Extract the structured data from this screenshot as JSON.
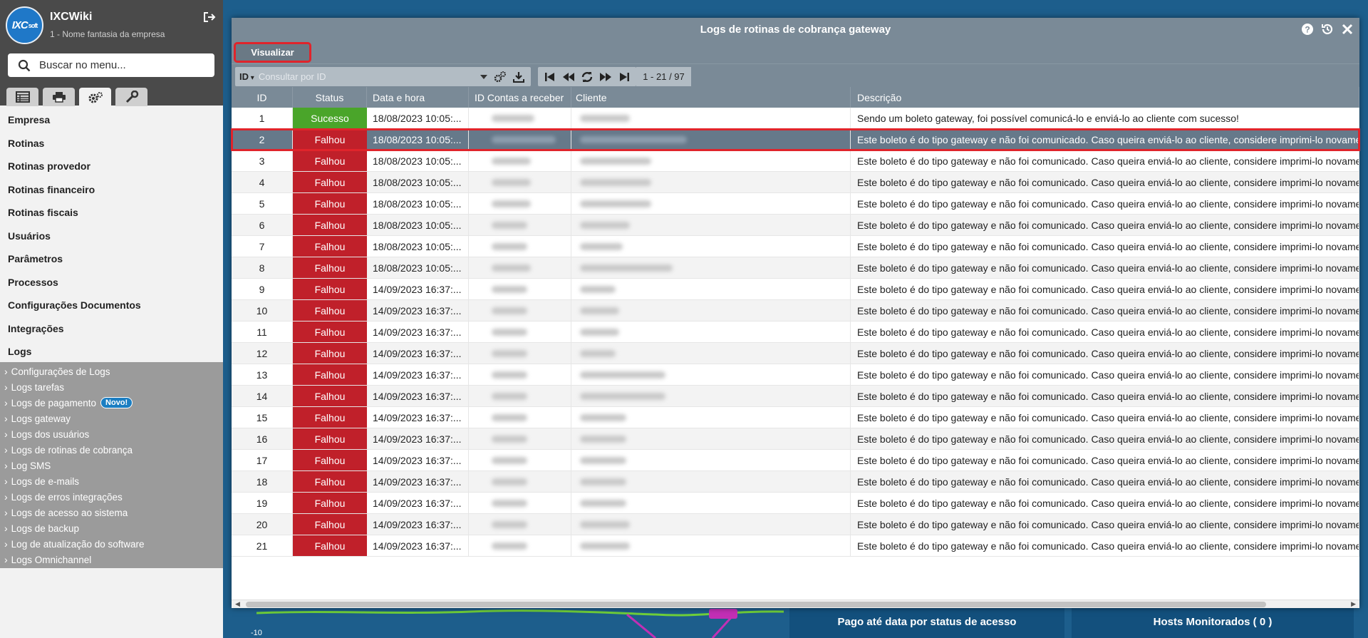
{
  "sidebar": {
    "app_name": "IXCWiki",
    "logo_text": "IXC",
    "logo_sub": "soft",
    "company": "1 - Nome fantasia da empresa",
    "search_placeholder": "Buscar no menu...",
    "tabs": [
      "table-icon",
      "print-icon",
      "gears-icon",
      "wrench-icon"
    ],
    "menu": [
      "Empresa",
      "Rotinas",
      "Rotinas provedor",
      "Rotinas financeiro",
      "Rotinas fiscais",
      "Usuários",
      "Parâmetros",
      "Processos",
      "Configurações Documentos",
      "Integrações",
      "Logs"
    ],
    "submenu": [
      "Configurações de Logs",
      "Logs tarefas",
      "Logs de pagamento",
      "Logs gateway",
      "Logs dos usuários",
      "Logs de rotinas de cobrança",
      "Log SMS",
      "Logs de e-mails",
      "Logs de erros integrações",
      "Logs de acesso ao sistema",
      "Logs de backup",
      "Log de atualização do software",
      "Logs Omnichannel"
    ],
    "new_badge": "Novo!"
  },
  "background": {
    "card1": "Pago até data por status de acesso",
    "card2": "Hosts Monitorados ( 0 )",
    "axis_label": "-10"
  },
  "modal": {
    "title": "Logs de rotinas de cobrança gateway",
    "view_button": "Visualizar",
    "filter_field": "ID",
    "filter_placeholder": "Consultar por ID",
    "pager_count": "1 - 21 / 97",
    "columns": [
      "ID",
      "Status",
      "Data e hora",
      "ID Contas a receber",
      "Cliente",
      "Descrição"
    ],
    "rows": [
      {
        "id": "1",
        "status": "Sucesso",
        "date": "18/08/2023 10:05:...",
        "desc": "Sendo um boleto gateway, foi possível comunicá-lo e enviá-lo ao cliente com sucesso!"
      },
      {
        "id": "2",
        "status": "Falhou",
        "date": "18/08/2023 10:05:...",
        "desc": "Este boleto é do tipo gateway e não foi comunicado. Caso queira enviá-lo ao cliente, considere imprimi-lo novamen"
      },
      {
        "id": "3",
        "status": "Falhou",
        "date": "18/08/2023 10:05:...",
        "desc": "Este boleto é do tipo gateway e não foi comunicado. Caso queira enviá-lo ao cliente, considere imprimi-lo novamen"
      },
      {
        "id": "4",
        "status": "Falhou",
        "date": "18/08/2023 10:05:...",
        "desc": "Este boleto é do tipo gateway e não foi comunicado. Caso queira enviá-lo ao cliente, considere imprimi-lo novamen"
      },
      {
        "id": "5",
        "status": "Falhou",
        "date": "18/08/2023 10:05:...",
        "desc": "Este boleto é do tipo gateway e não foi comunicado. Caso queira enviá-lo ao cliente, considere imprimi-lo novamen"
      },
      {
        "id": "6",
        "status": "Falhou",
        "date": "18/08/2023 10:05:...",
        "desc": "Este boleto é do tipo gateway e não foi comunicado. Caso queira enviá-lo ao cliente, considere imprimi-lo novamen"
      },
      {
        "id": "7",
        "status": "Falhou",
        "date": "18/08/2023 10:05:...",
        "desc": "Este boleto é do tipo gateway e não foi comunicado. Caso queira enviá-lo ao cliente, considere imprimi-lo novamen"
      },
      {
        "id": "8",
        "status": "Falhou",
        "date": "18/08/2023 10:05:...",
        "desc": "Este boleto é do tipo gateway e não foi comunicado. Caso queira enviá-lo ao cliente, considere imprimi-lo novamen"
      },
      {
        "id": "9",
        "status": "Falhou",
        "date": "14/09/2023 16:37:...",
        "desc": "Este boleto é do tipo gateway e não foi comunicado. Caso queira enviá-lo ao cliente, considere imprimi-lo novamen"
      },
      {
        "id": "10",
        "status": "Falhou",
        "date": "14/09/2023 16:37:...",
        "desc": "Este boleto é do tipo gateway e não foi comunicado. Caso queira enviá-lo ao cliente, considere imprimi-lo novamen"
      },
      {
        "id": "11",
        "status": "Falhou",
        "date": "14/09/2023 16:37:...",
        "desc": "Este boleto é do tipo gateway e não foi comunicado. Caso queira enviá-lo ao cliente, considere imprimi-lo novamen"
      },
      {
        "id": "12",
        "status": "Falhou",
        "date": "14/09/2023 16:37:...",
        "desc": "Este boleto é do tipo gateway e não foi comunicado. Caso queira enviá-lo ao cliente, considere imprimi-lo novamen"
      },
      {
        "id": "13",
        "status": "Falhou",
        "date": "14/09/2023 16:37:...",
        "desc": "Este boleto é do tipo gateway e não foi comunicado. Caso queira enviá-lo ao cliente, considere imprimi-lo novamen"
      },
      {
        "id": "14",
        "status": "Falhou",
        "date": "14/09/2023 16:37:...",
        "desc": "Este boleto é do tipo gateway e não foi comunicado. Caso queira enviá-lo ao cliente, considere imprimi-lo novamen"
      },
      {
        "id": "15",
        "status": "Falhou",
        "date": "14/09/2023 16:37:...",
        "desc": "Este boleto é do tipo gateway e não foi comunicado. Caso queira enviá-lo ao cliente, considere imprimi-lo novamen"
      },
      {
        "id": "16",
        "status": "Falhou",
        "date": "14/09/2023 16:37:...",
        "desc": "Este boleto é do tipo gateway e não foi comunicado. Caso queira enviá-lo ao cliente, considere imprimi-lo novamen"
      },
      {
        "id": "17",
        "status": "Falhou",
        "date": "14/09/2023 16:37:...",
        "desc": "Este boleto é do tipo gateway e não foi comunicado. Caso queira enviá-lo ao cliente, considere imprimi-lo novamen"
      },
      {
        "id": "18",
        "status": "Falhou",
        "date": "14/09/2023 16:37:...",
        "desc": "Este boleto é do tipo gateway e não foi comunicado. Caso queira enviá-lo ao cliente, considere imprimi-lo novamen"
      },
      {
        "id": "19",
        "status": "Falhou",
        "date": "14/09/2023 16:37:...",
        "desc": "Este boleto é do tipo gateway e não foi comunicado. Caso queira enviá-lo ao cliente, considere imprimi-lo novamen"
      },
      {
        "id": "20",
        "status": "Falhou",
        "date": "14/09/2023 16:37:...",
        "desc": "Este boleto é do tipo gateway e não foi comunicado. Caso queira enviá-lo ao cliente, considere imprimi-lo novamen"
      },
      {
        "id": "21",
        "status": "Falhou",
        "date": "14/09/2023 16:37:...",
        "desc": "Este boleto é do tipo gateway e não foi comunicado. Caso queira enviá-lo ao cliente, considere imprimi-lo novamen"
      }
    ],
    "selected_row": "2"
  },
  "colors": {
    "sidebar_head": "#4a4a4a",
    "accent_blue": "#1d5e8c",
    "modal_bar": "#7a8a97",
    "fail": "#c0202a",
    "success": "#4aa52a",
    "highlight": "#e0242b"
  }
}
